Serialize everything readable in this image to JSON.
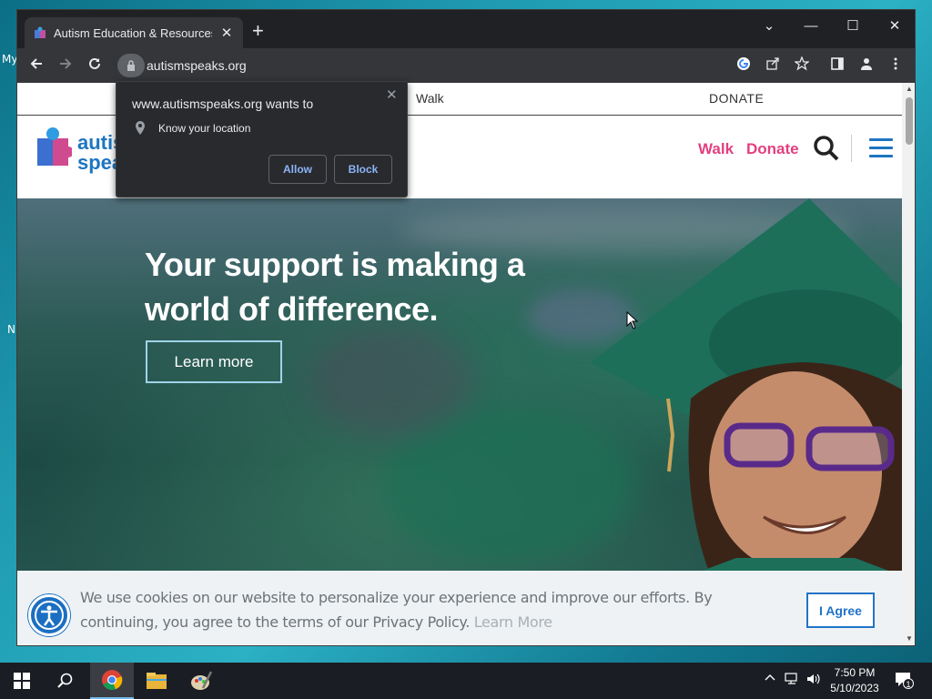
{
  "desktop": {
    "left_labels": [
      "My",
      "N"
    ]
  },
  "browser": {
    "tab_title": "Autism Education & Resources | /",
    "tab_close": "✕",
    "new_tab": "+",
    "url": "autismspeaks.org",
    "window_controls": [
      "⌄",
      "—",
      "☐",
      "✕"
    ]
  },
  "permission_popup": {
    "title": "www.autismspeaks.org wants to",
    "permission": "Know your location",
    "allow_label": "Allow",
    "block_label": "Block",
    "close": "✕"
  },
  "site": {
    "util_walk": "Walk",
    "util_donate": "DONATE",
    "logo_line1": "autis",
    "logo_line2": "spea",
    "nav_walk": "Walk",
    "nav_donate": "Donate",
    "brand_pink": "#e2407f",
    "brand_blue": "#1e75c1"
  },
  "hero": {
    "title": "Your support is making a world of difference.",
    "button_label": "Learn more"
  },
  "cookie_banner": {
    "text": "We use cookies on our website to personalize your experience and improve our efforts. By continuing, you agree to the terms of our Privacy Policy.",
    "link_label": "Learn More",
    "agree_label": "I Agree"
  },
  "taskbar": {
    "time": "7:50 PM",
    "date": "5/10/2023",
    "notification_count": "1"
  }
}
